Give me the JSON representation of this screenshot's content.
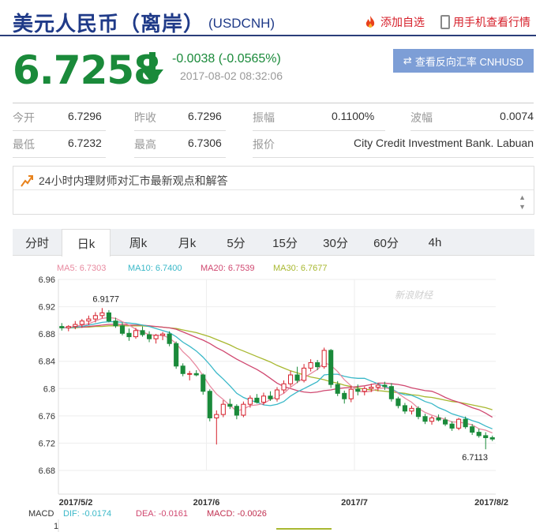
{
  "header": {
    "title": "美元人民币（离岸）",
    "code": "(USDCNH)",
    "add_favorite": "添加自选",
    "mobile_view": "用手机查看行情"
  },
  "quote": {
    "price": "6.7258",
    "change": "-0.0038 (-0.0565%)",
    "time": "2017-08-02 08:32:06",
    "reverse_button": "查看反向汇率 CNHUSD"
  },
  "stats": {
    "row1": [
      {
        "label": "今开",
        "value": "6.7296"
      },
      {
        "label": "昨收",
        "value": "6.7296"
      },
      {
        "label": "振幅",
        "value": "0.1100%"
      },
      {
        "label": "波幅",
        "value": "0.0074"
      }
    ],
    "row2": [
      {
        "label": "最低",
        "value": "6.7232"
      },
      {
        "label": "最高",
        "value": "6.7306"
      },
      {
        "label": "报价",
        "value": "City Credit Investment Bank. Labuan"
      }
    ]
  },
  "opinion": {
    "title": "24小时内理财师对汇市最新观点和解答"
  },
  "tabs": [
    "分时",
    "日k",
    "周k",
    "月k",
    "5分",
    "15分",
    "30分",
    "60分",
    "4h"
  ],
  "active_tab": "日k",
  "colors": {
    "up": "#d6202b",
    "down": "#1a8a3a",
    "title": "#1f3a88",
    "ma5": "#e88aa0",
    "ma10": "#3ab8c8",
    "ma20": "#d04870",
    "ma30": "#a8b830"
  },
  "chart_data": {
    "type": "candlestick",
    "ma_labels": [
      {
        "name": "MA5",
        "text": "MA5: 6.7303",
        "color": "#e88aa0"
      },
      {
        "name": "MA10",
        "text": "MA10: 6.7400",
        "color": "#3ab8c8"
      },
      {
        "name": "MA20",
        "text": "MA20: 6.7539",
        "color": "#d04870"
      },
      {
        "name": "MA30",
        "text": "MA30: 6.7677",
        "color": "#a8b830"
      }
    ],
    "y_ticks": [
      "6.96",
      "6.92",
      "6.88",
      "6.84",
      "6.8",
      "6.76",
      "6.72",
      "6.68"
    ],
    "ylim": [
      6.68,
      6.96
    ],
    "x_ticks": [
      "2017/5/2",
      "2017/6",
      "2017/7",
      "2017/8/2"
    ],
    "x_tick_index": [
      0,
      22,
      44,
      66
    ],
    "high_annotation": "6.9177",
    "low_annotation": "6.7113",
    "watermark": "新浪财经",
    "macd_labels": {
      "title": "MACD",
      "dif": "DIF: -0.0174",
      "dea": "DEA: -0.0161",
      "macd": "MACD: -0.0026",
      "axis_top": "1"
    },
    "candles": [
      [
        6.891,
        6.896,
        6.885,
        6.889
      ],
      [
        6.889,
        6.893,
        6.884,
        6.891
      ],
      [
        6.891,
        6.899,
        6.887,
        6.894
      ],
      [
        6.894,
        6.902,
        6.889,
        6.899
      ],
      [
        6.899,
        6.907,
        6.893,
        6.902
      ],
      [
        6.902,
        6.912,
        6.897,
        6.907
      ],
      [
        6.907,
        6.918,
        6.903,
        6.911
      ],
      [
        6.911,
        6.915,
        6.897,
        6.899
      ],
      [
        6.899,
        6.904,
        6.889,
        6.892
      ],
      [
        6.892,
        6.897,
        6.878,
        6.881
      ],
      [
        6.881,
        6.888,
        6.87,
        6.876
      ],
      [
        6.876,
        6.889,
        6.873,
        6.885
      ],
      [
        6.885,
        6.891,
        6.876,
        6.879
      ],
      [
        6.879,
        6.884,
        6.868,
        6.873
      ],
      [
        6.873,
        6.88,
        6.866,
        6.878
      ],
      [
        6.878,
        6.883,
        6.871,
        6.88
      ],
      [
        6.88,
        6.884,
        6.862,
        6.866
      ],
      [
        6.866,
        6.869,
        6.829,
        6.833
      ],
      [
        6.833,
        6.837,
        6.818,
        6.822
      ],
      [
        6.822,
        6.826,
        6.812,
        6.822
      ],
      [
        6.822,
        6.827,
        6.818,
        6.82
      ],
      [
        6.82,
        6.822,
        6.791,
        6.796
      ],
      [
        6.796,
        6.799,
        6.752,
        6.757
      ],
      [
        6.757,
        6.768,
        6.718,
        6.762
      ],
      [
        6.762,
        6.783,
        6.758,
        6.777
      ],
      [
        6.777,
        6.785,
        6.77,
        6.774
      ],
      [
        6.774,
        6.777,
        6.755,
        6.761
      ],
      [
        6.761,
        6.781,
        6.758,
        6.777
      ],
      [
        6.777,
        6.79,
        6.772,
        6.786
      ],
      [
        6.786,
        6.792,
        6.778,
        6.78
      ],
      [
        6.78,
        6.794,
        6.776,
        6.789
      ],
      [
        6.789,
        6.796,
        6.782,
        6.785
      ],
      [
        6.785,
        6.802,
        6.781,
        6.798
      ],
      [
        6.798,
        6.812,
        6.793,
        6.807
      ],
      [
        6.807,
        6.826,
        6.803,
        6.82
      ],
      [
        6.82,
        6.832,
        6.808,
        6.812
      ],
      [
        6.812,
        6.836,
        6.809,
        6.83
      ],
      [
        6.83,
        6.843,
        6.825,
        6.838
      ],
      [
        6.838,
        6.842,
        6.827,
        6.832
      ],
      [
        6.832,
        6.86,
        6.829,
        6.856
      ],
      [
        6.856,
        6.858,
        6.801,
        6.806
      ],
      [
        6.806,
        6.811,
        6.789,
        6.793
      ],
      [
        6.793,
        6.797,
        6.778,
        6.785
      ],
      [
        6.785,
        6.804,
        6.78,
        6.799
      ],
      [
        6.799,
        6.806,
        6.79,
        6.796
      ],
      [
        6.796,
        6.803,
        6.79,
        6.8
      ],
      [
        6.8,
        6.807,
        6.795,
        6.802
      ],
      [
        6.802,
        6.808,
        6.796,
        6.805
      ],
      [
        6.805,
        6.81,
        6.798,
        6.803
      ],
      [
        6.803,
        6.808,
        6.781,
        6.785
      ],
      [
        6.785,
        6.788,
        6.771,
        6.775
      ],
      [
        6.775,
        6.779,
        6.763,
        6.767
      ],
      [
        6.767,
        6.775,
        6.762,
        6.771
      ],
      [
        6.771,
        6.774,
        6.755,
        6.759
      ],
      [
        6.759,
        6.763,
        6.748,
        6.752
      ],
      [
        6.752,
        6.76,
        6.747,
        6.757
      ],
      [
        6.757,
        6.762,
        6.752,
        6.754
      ],
      [
        6.754,
        6.758,
        6.745,
        6.748
      ],
      [
        6.748,
        6.752,
        6.738,
        6.742
      ],
      [
        6.742,
        6.757,
        6.739,
        6.755
      ],
      [
        6.755,
        6.759,
        6.741,
        6.744
      ],
      [
        6.744,
        6.748,
        6.732,
        6.736
      ],
      [
        6.736,
        6.741,
        6.728,
        6.731
      ],
      [
        6.731,
        6.736,
        6.711,
        6.728
      ],
      [
        6.728,
        6.731,
        6.723,
        6.726
      ]
    ],
    "ma5": [
      6.889,
      6.89,
      6.891,
      6.893,
      6.895,
      6.899,
      6.903,
      6.904,
      6.903,
      6.898,
      6.893,
      6.887,
      6.883,
      6.879,
      6.878,
      6.878,
      6.874,
      6.866,
      6.854,
      6.845,
      6.833,
      6.819,
      6.804,
      6.792,
      6.784,
      6.775,
      6.767,
      6.77,
      6.775,
      6.776,
      6.778,
      6.784,
      6.788,
      6.793,
      6.802,
      6.809,
      6.816,
      6.822,
      6.828,
      6.838,
      6.834,
      6.825,
      6.813,
      6.804,
      6.796,
      6.795,
      6.796,
      6.8,
      6.801,
      6.799,
      6.793,
      6.786,
      6.78,
      6.771,
      6.765,
      6.761,
      6.758,
      6.755,
      6.751,
      6.751,
      6.749,
      6.747,
      6.741,
      6.739,
      6.735
    ],
    "ma10": [
      6.889,
      6.889,
      6.89,
      6.891,
      6.893,
      6.895,
      6.897,
      6.898,
      6.898,
      6.897,
      6.896,
      6.895,
      6.893,
      6.891,
      6.888,
      6.885,
      6.882,
      6.876,
      6.868,
      6.862,
      6.855,
      6.846,
      6.835,
      6.823,
      6.814,
      6.804,
      6.793,
      6.787,
      6.783,
      6.78,
      6.776,
      6.775,
      6.777,
      6.781,
      6.789,
      6.795,
      6.8,
      6.805,
      6.81,
      6.82,
      6.821,
      6.821,
      6.818,
      6.816,
      6.815,
      6.815,
      6.811,
      6.807,
      6.803,
      6.8,
      6.794,
      6.791,
      6.79,
      6.786,
      6.781,
      6.778,
      6.772,
      6.768,
      6.763,
      6.76,
      6.757,
      6.753,
      6.75,
      6.745,
      6.741
    ],
    "ma20": [
      6.889,
      6.889,
      6.89,
      6.89,
      6.891,
      6.892,
      6.893,
      6.894,
      6.894,
      6.894,
      6.893,
      6.893,
      6.893,
      6.892,
      6.891,
      6.89,
      6.889,
      6.887,
      6.883,
      6.879,
      6.875,
      6.871,
      6.866,
      6.86,
      6.855,
      6.849,
      6.843,
      6.838,
      6.833,
      6.828,
      6.822,
      6.815,
      6.808,
      6.803,
      6.8,
      6.797,
      6.795,
      6.794,
      6.795,
      6.797,
      6.798,
      6.8,
      6.801,
      6.802,
      6.803,
      6.804,
      6.806,
      6.808,
      6.808,
      6.807,
      6.806,
      6.804,
      6.801,
      6.799,
      6.797,
      6.796,
      6.792,
      6.787,
      6.783,
      6.78,
      6.776,
      6.772,
      6.769,
      6.764,
      6.758
    ],
    "ma30": [
      6.889,
      6.889,
      6.889,
      6.89,
      6.89,
      6.891,
      6.891,
      6.892,
      6.892,
      6.892,
      6.892,
      6.892,
      6.892,
      6.891,
      6.891,
      6.89,
      6.889,
      6.888,
      6.886,
      6.884,
      6.882,
      6.879,
      6.876,
      6.872,
      6.868,
      6.864,
      6.859,
      6.855,
      6.851,
      6.847,
      6.843,
      6.839,
      6.834,
      6.83,
      6.826,
      6.823,
      6.82,
      6.817,
      6.815,
      6.813,
      6.81,
      6.808,
      6.805,
      6.803,
      6.801,
      6.799,
      6.798,
      6.797,
      6.796,
      6.795,
      6.794,
      6.793,
      6.791,
      6.79,
      6.788,
      6.787,
      6.785,
      6.783,
      6.781,
      6.78,
      6.778,
      6.776,
      6.774,
      6.772,
      6.769
    ]
  }
}
